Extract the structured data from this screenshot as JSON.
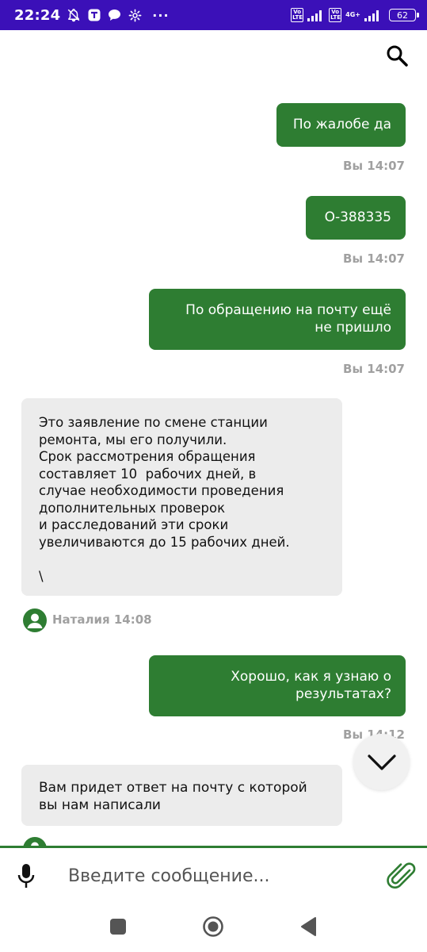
{
  "status_bar": {
    "time": "22:24",
    "more": "···",
    "volte_label": "Vo LTE",
    "network_type": "4G+",
    "battery": "62"
  },
  "header": {
    "search_icon": "search-icon"
  },
  "messages": [
    {
      "side": "out",
      "text": "По жалобе да",
      "meta": "Вы 14:07"
    },
    {
      "side": "out",
      "text": "О-388335",
      "meta": "Вы 14:07"
    },
    {
      "side": "out",
      "text": "По обращению на почту ещё\nне пришло",
      "meta": "Вы 14:07"
    },
    {
      "side": "in",
      "text": "Это заявление по смене станции\nремонта, мы его получили.\nСрок рассмотрения обращения\nсоставляет 10  рабочих дней, в\nслучае необходимости проведения\nдополнительных проверок\nи расследований эти сроки\nувеличиваются до 15 рабочих дней.\n\n\\",
      "meta": "Наталия 14:08"
    },
    {
      "side": "out",
      "text": "Хорошо, как я узнаю о\nрезультатах?",
      "meta": "Вы 14:12"
    },
    {
      "side": "in",
      "text": "Вам придет ответ на почту с которой\nвы нам написали",
      "meta": ""
    }
  ],
  "composer": {
    "placeholder": "Введите сообщение...",
    "mic_icon": "microphone-icon",
    "attach_icon": "paperclip-icon"
  },
  "colors": {
    "status_bar": "#3b10b8",
    "accent_green": "#2e7d32",
    "incoming_bubble": "#ececec",
    "meta_text": "#a0a0a0"
  }
}
